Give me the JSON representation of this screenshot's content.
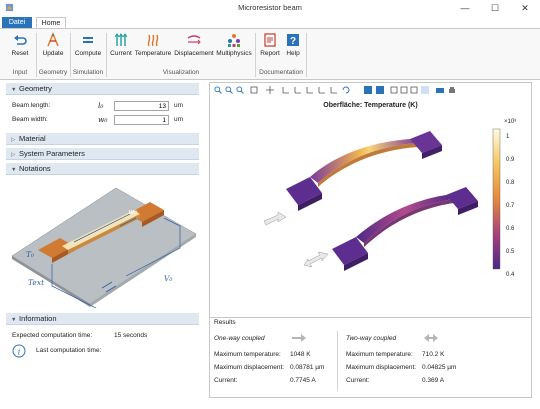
{
  "window": {
    "title": "Microresistor beam",
    "minimize": "—",
    "maximize": "☐",
    "close": "✕"
  },
  "tabs": {
    "file": "Datei",
    "home": "Home"
  },
  "ribbon": {
    "reset": "Reset",
    "update": "Update",
    "compute": "Compute",
    "current": "Current",
    "temperature": "Temperature",
    "displacement": "Displacement",
    "multiphysics": "Multiphysics",
    "report": "Report",
    "help": "Help",
    "groups": {
      "input": "Input",
      "geometry": "Geometry",
      "simulation": "Simulation",
      "visualization": "Visualization",
      "documentation": "Documentation"
    }
  },
  "geometry": {
    "header": "Geometry",
    "beam_length_label": "Beam length:",
    "beam_length_symbol": "l₀",
    "beam_length_value": "13",
    "beam_length_unit": "um",
    "beam_width_label": "Beam width:",
    "beam_width_symbol": "w₀",
    "beam_width_value": "1",
    "beam_width_unit": "um"
  },
  "sections": {
    "material": "Material",
    "system_parameters": "System Parameters",
    "notations": "Notations",
    "information": "Information"
  },
  "notation_labels": {
    "l0": "l₀",
    "w0": "w₀",
    "t0": "T₀",
    "text": "Text",
    "v0": "V₀"
  },
  "information": {
    "expected_label": "Expected computation time:",
    "expected_value": "15 seconds",
    "last_label": "Last computation time:",
    "last_value": ""
  },
  "plot": {
    "title": "Oberfläche: Temperature (K)",
    "colorbar_exponent": "×10³",
    "colorbar_ticks": [
      "1",
      "0.9",
      "0.8",
      "0.7",
      "0.6",
      "0.5",
      "0.4"
    ],
    "colors": {
      "high": "#fffce0",
      "mid": "#e58a3c",
      "low": "#5a2a8c"
    }
  },
  "results": {
    "title": "Results",
    "one_way": {
      "header": "One-way coupled",
      "max_temp_label": "Maximum temperature:",
      "max_temp_value": "1048 K",
      "max_disp_label": "Maximum displacement:",
      "max_disp_value": "0.08781 µm",
      "current_label": "Current:",
      "current_value": "0.7745 A"
    },
    "two_way": {
      "header": "Two-way coupled",
      "max_temp_label": "Maximum temperature:",
      "max_temp_value": "710.2 K",
      "max_disp_label": "Maximum displacement:",
      "max_disp_value": "0.04825 µm",
      "current_label": "Current:",
      "current_value": "0.369 A"
    }
  },
  "accent": "#2b73b8"
}
